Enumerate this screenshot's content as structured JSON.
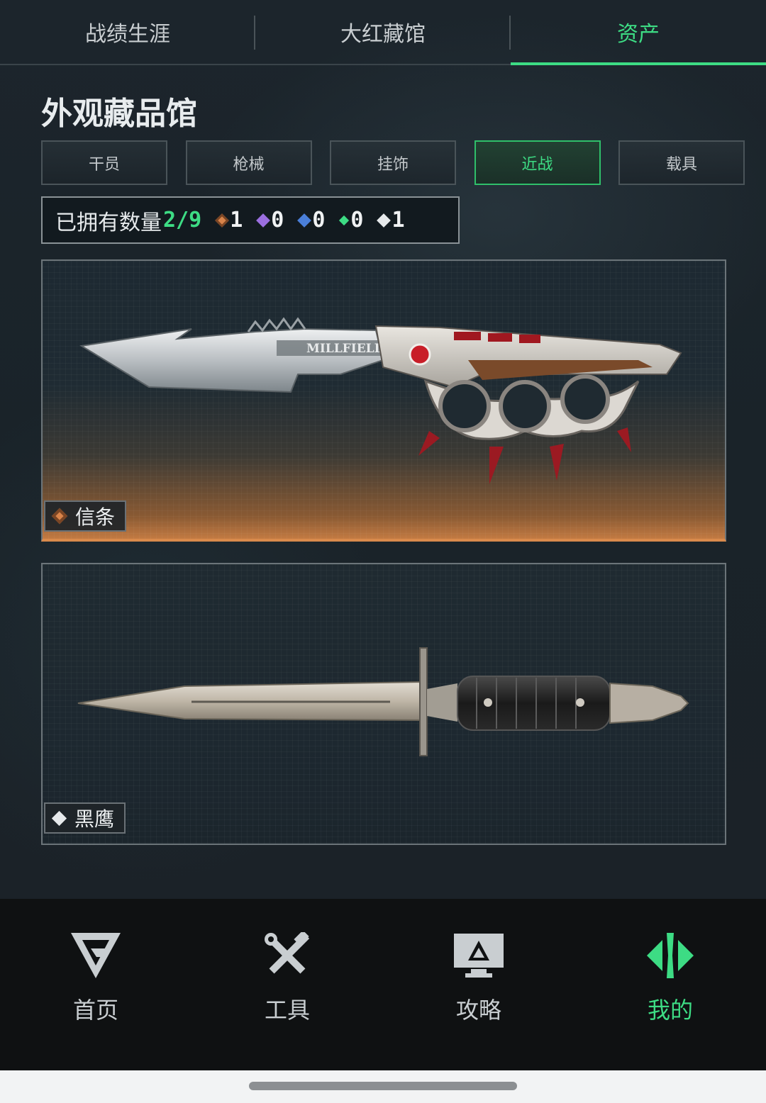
{
  "top_tabs": [
    {
      "label": "战绩生涯",
      "active": false
    },
    {
      "label": "大红藏馆",
      "active": false
    },
    {
      "label": "资产",
      "active": true
    }
  ],
  "page_title": "外观藏品馆",
  "categories": [
    {
      "label": "干员",
      "active": false
    },
    {
      "label": "枪械",
      "active": false
    },
    {
      "label": "挂饰",
      "active": false
    },
    {
      "label": "近战",
      "active": true
    },
    {
      "label": "载具",
      "active": false
    }
  ],
  "owned": {
    "label": "已拥有数量",
    "value": "2/9",
    "rarities": [
      {
        "icon": "orange-diamond-icon",
        "color": "#d9844a",
        "count": "1"
      },
      {
        "icon": "purple-diamond-icon",
        "color": "#9b6fe0",
        "count": "0"
      },
      {
        "icon": "blue-diamond-icon",
        "color": "#4a7fd9",
        "count": "0"
      },
      {
        "icon": "green-diamond-icon",
        "color": "#3ddc84",
        "count": "0"
      },
      {
        "icon": "white-diamond-icon",
        "color": "#e6e9eb",
        "count": "1"
      }
    ]
  },
  "items": [
    {
      "name": "信条",
      "rarity_icon": "orange-diamond-icon",
      "rarity_color": "#d9844a",
      "blade_text": "MILLFIELD"
    },
    {
      "name": "黑鹰",
      "rarity_icon": "white-diamond-icon",
      "rarity_color": "#e6e9eb"
    }
  ],
  "bottom_nav": [
    {
      "label": "首页",
      "icon": "home-logo-icon",
      "active": false
    },
    {
      "label": "工具",
      "icon": "tools-icon",
      "active": false
    },
    {
      "label": "攻略",
      "icon": "guide-monitor-icon",
      "active": false
    },
    {
      "label": "我的",
      "icon": "profile-logo-icon",
      "active": true
    }
  ],
  "colors": {
    "accent": "#3ddc84",
    "background": "#1a2228",
    "nav_background": "#0f1112"
  }
}
